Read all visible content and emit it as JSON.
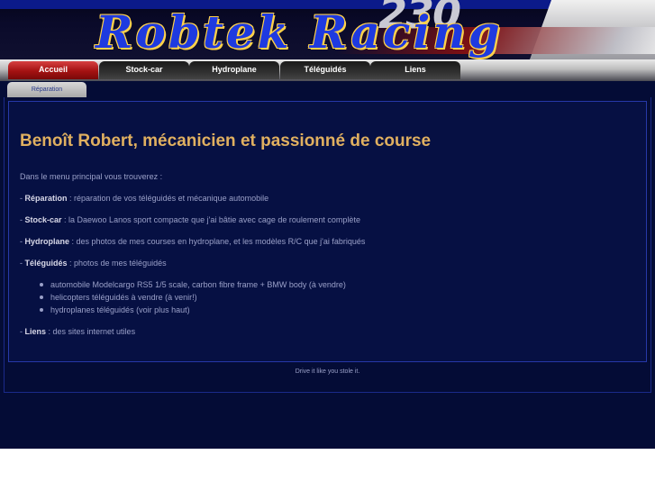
{
  "header": {
    "logo_text": "Robtek Racing",
    "logo_number": "230"
  },
  "nav": {
    "tabs": [
      {
        "label": "Accueil",
        "active": true
      },
      {
        "label": "Stock-car",
        "active": false
      },
      {
        "label": "Hydroplane",
        "active": false
      },
      {
        "label": "Téléguidés",
        "active": false
      },
      {
        "label": "Liens",
        "active": false
      }
    ],
    "subtabs": [
      {
        "label": "Réparation"
      }
    ]
  },
  "main": {
    "title": "Benoît Robert, mécanicien et passionné de course",
    "intro": "Dans le menu principal vous trouverez :",
    "items": [
      {
        "prefix": "- ",
        "term": "Réparation",
        "text": " :  réparation de vos téléguidés et mécanique automobile"
      },
      {
        "prefix": "- ",
        "term": "Stock-car",
        "text": " : la Daewoo Lanos sport compacte que j'ai bâtie avec cage de roulement complète"
      },
      {
        "prefix": "- ",
        "term": "Hydroplane",
        "text": " : des photos de mes courses en hydroplane, et les modèles R/C que j'ai fabriqués"
      },
      {
        "prefix": "- ",
        "term": "Téléguidés",
        "text": " : photos de mes téléguidés"
      }
    ],
    "bullets": [
      "automobile Modelcargo RS5 1/5 scale, carbon fibre frame + BMW body (à vendre)",
      "helicopters téléguidés à vendre (à venir!)",
      "hydroplanes téléguidés (voir plus haut)"
    ],
    "last_item": {
      "prefix": "-  ",
      "term": "Liens",
      "text": " : des sites internet utiles"
    }
  },
  "footer": {
    "text": "Drive it like you stole it."
  },
  "colors": {
    "background": "#040c36",
    "title": "#e0b060",
    "active_tab": "#a41212",
    "logo": "#1e3ae0"
  }
}
